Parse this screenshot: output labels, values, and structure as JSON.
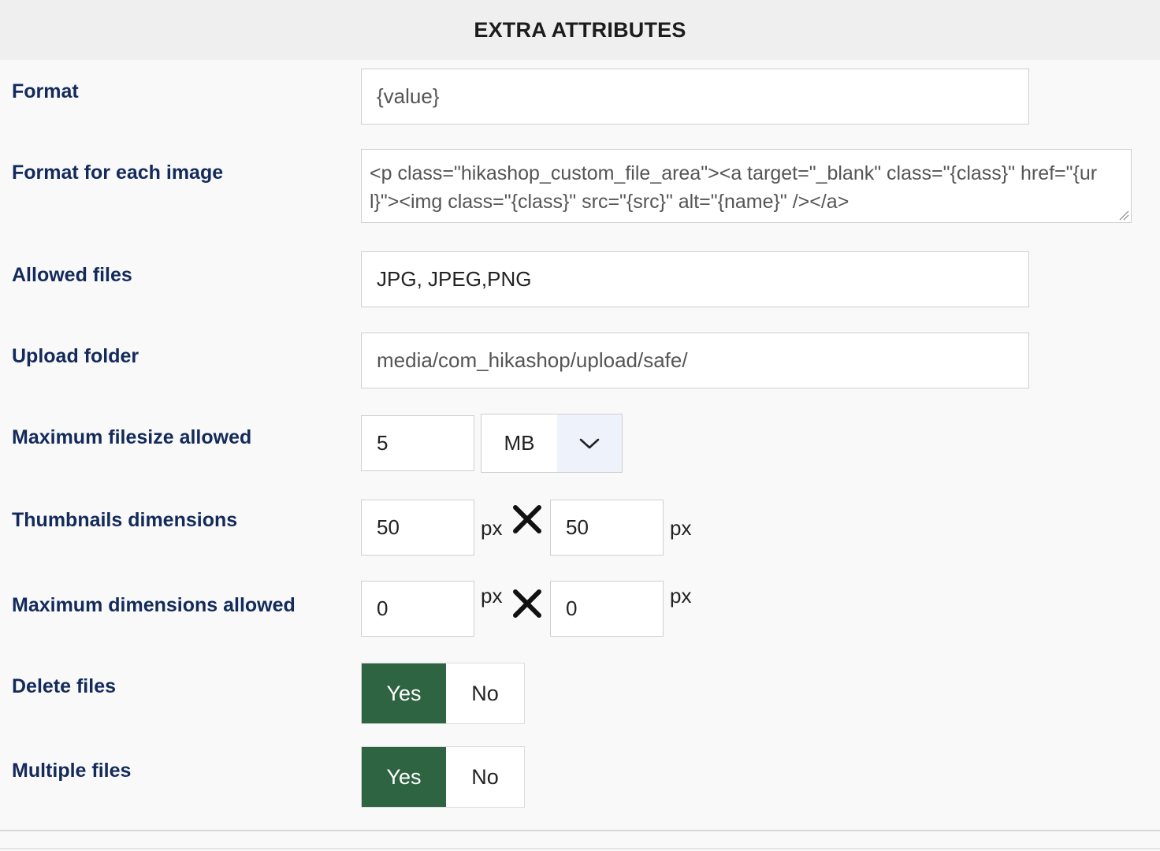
{
  "header": {
    "title": "EXTRA ATTRIBUTES"
  },
  "fields": {
    "format": {
      "label": "Format",
      "value": "{value}"
    },
    "format_each_image": {
      "label": "Format for each image",
      "value": "<p class=\"hikashop_custom_file_area\"><a target=\"_blank\" class=\"{class}\" href=\"{url}\"><img class=\"{class}\" src=\"{src}\" alt=\"{name}\" /></a>"
    },
    "allowed_files": {
      "label": "Allowed files",
      "value": "JPG, JPEG,PNG"
    },
    "upload_folder": {
      "label": "Upload folder",
      "value": "media/com_hikashop/upload/safe/"
    },
    "max_filesize": {
      "label": "Maximum filesize allowed",
      "value": "5",
      "unit_selected": "MB"
    },
    "thumbnails": {
      "label": "Thumbnails dimensions",
      "width": "50",
      "height": "50",
      "unit": "px"
    },
    "max_dimensions": {
      "label": "Maximum dimensions allowed",
      "width": "0",
      "height": "0",
      "unit": "px"
    },
    "delete_files": {
      "label": "Delete files",
      "yes": "Yes",
      "no": "No",
      "selected": "Yes"
    },
    "multiple_files": {
      "label": "Multiple files",
      "yes": "Yes",
      "no": "No",
      "selected": "Yes"
    }
  },
  "colors": {
    "label": "#132a5a",
    "toggle_active": "#2f6442",
    "header_bg": "#efefef"
  },
  "icons": {
    "times": "times-icon",
    "chevron": "chevron-down-icon",
    "grip": "resize-grip-icon"
  }
}
